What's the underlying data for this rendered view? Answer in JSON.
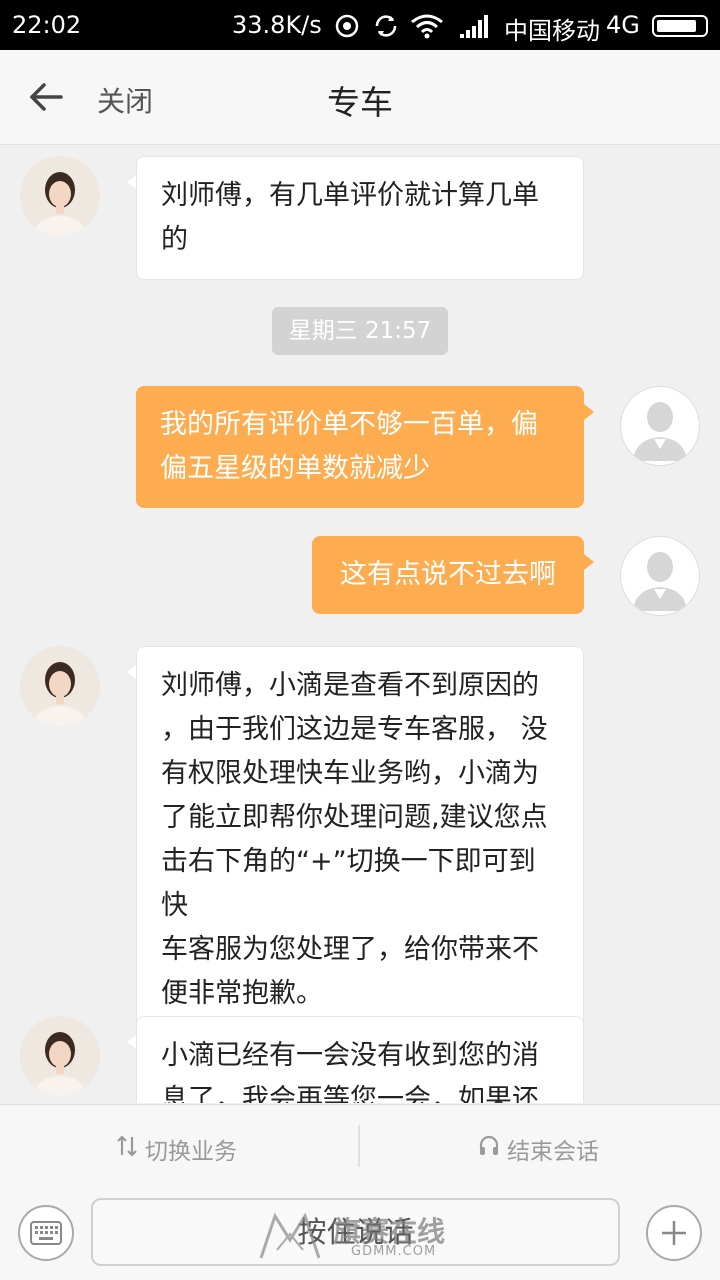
{
  "status_bar": {
    "time": "22:02",
    "speed": "33.8K/s",
    "carrier": "中国移动",
    "network": "4G",
    "icons": [
      "alarm-icon",
      "sync-icon",
      "wifi-icon",
      "signal-icon",
      "battery-icon"
    ],
    "battery_level": 0.85
  },
  "nav": {
    "back_icon": "arrow-left-icon",
    "close_label": "关闭",
    "title": "专车"
  },
  "messages": [
    {
      "side": "left",
      "avatar": "agent-avatar",
      "lines": [
        "刘师傅，有几单评价就计算几单",
        "的"
      ]
    },
    {
      "type": "timestamp",
      "text": "星期三 21:57"
    },
    {
      "side": "right",
      "avatar": "user-avatar",
      "lines": [
        "我的所有评价单不够一百单，偏",
        "偏五星级的单数就减少"
      ]
    },
    {
      "side": "right",
      "avatar": "user-avatar",
      "lines": [
        "这有点说不过去啊"
      ]
    },
    {
      "side": "left",
      "avatar": "agent-avatar",
      "lines": [
        "刘师傅，小滴是查看不到原因的",
        "，由于我们这边是专车客服， 没",
        "有权限处理快车业务哟，小滴为",
        "了能立即帮你处理问题,建议您点",
        "击右下角的“+”切换一下即可到快",
        "车客服为您处理了，给你带来不",
        "便非常抱歉。"
      ]
    },
    {
      "side": "left",
      "avatar": "agent-avatar",
      "lines": [
        "小滴已经有一会没有收到您的消",
        "息了，我会再等您一会，如果还"
      ]
    }
  ],
  "actions": {
    "switch_label": "切换业务",
    "switch_icon": "switch-arrows-icon",
    "end_label": "结束会话",
    "end_icon": "headset-icon"
  },
  "input": {
    "keyboard_icon": "keyboard-icon",
    "hold_label": "按住说话",
    "plus_icon": "plus-icon"
  },
  "watermark": {
    "text": "旗赛在线",
    "sub": "GDMM.COM"
  },
  "colors": {
    "outgoing_bubble": "#fdac4f",
    "incoming_bubble": "#ffffff",
    "chat_background": "#f0f0f0",
    "status_bar": "#000000"
  }
}
